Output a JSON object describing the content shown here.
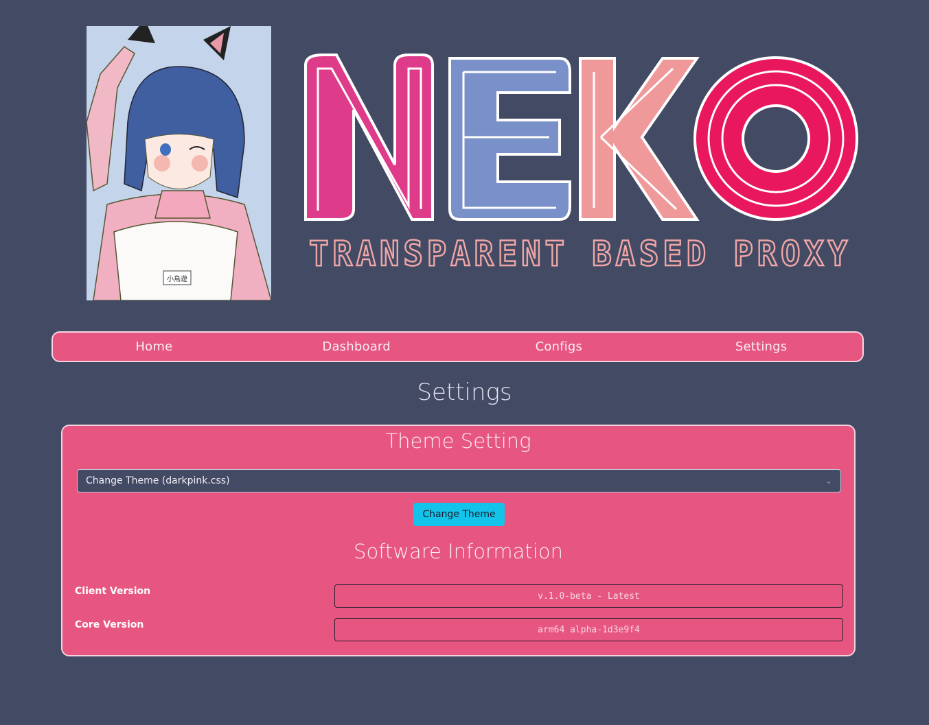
{
  "banner": {
    "logo_text": "NEKO",
    "logo_subtitle": "TRANSPARENT BASED PROXY",
    "mascot_name_tag": "小鳥遊",
    "colors": {
      "n": "#de3b8a",
      "e": "#7a90c8",
      "k": "#f0999a",
      "o": "#e8175e",
      "subtitle_outline": "#f0a6a6"
    }
  },
  "nav": {
    "items": [
      {
        "label": "Home"
      },
      {
        "label": "Dashboard"
      },
      {
        "label": "Configs"
      },
      {
        "label": "Settings"
      }
    ]
  },
  "page": {
    "title": "Settings"
  },
  "theme_section": {
    "title": "Theme Setting",
    "select_value": "Change Theme (darkpink.css)",
    "button_label": "Change Theme"
  },
  "software_section": {
    "title": "Software Information",
    "rows": [
      {
        "label": "Client Version",
        "value": "v.1.0-beta - Latest"
      },
      {
        "label": "Core Version",
        "value": "arm64 alpha-1d3e9f4"
      }
    ]
  },
  "colors": {
    "background": "#424a64",
    "accent": "#e75581",
    "button": "#13c3ea"
  }
}
